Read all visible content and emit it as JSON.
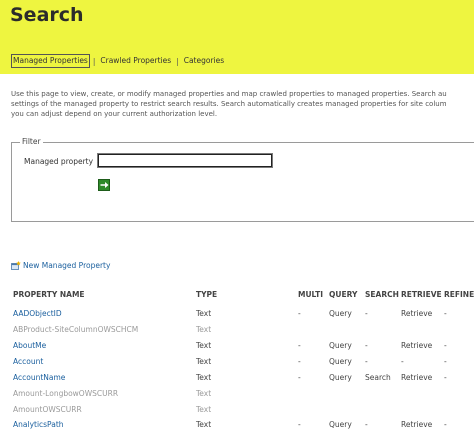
{
  "page": {
    "title": "Search"
  },
  "tabs": [
    {
      "label": "Managed Properties",
      "active": true
    },
    {
      "label": "Crawled Properties",
      "active": false
    },
    {
      "label": "Categories",
      "active": false
    }
  ],
  "tab_separator": "|",
  "description": {
    "line1": "Use this page to view, create, or modify managed properties and map crawled properties to managed properties. Search au",
    "line2": "settings of the managed property to restrict search results. Search automatically creates managed properties for site colum",
    "line3": "you can adjust depend on your current authorization level."
  },
  "filter": {
    "legend": "Filter",
    "label": "Managed property",
    "value": ""
  },
  "new_property_link": "New Managed Property",
  "table": {
    "headers": {
      "name": "PROPERTY NAME",
      "type": "TYPE",
      "multi": "MULTI",
      "query": "QUERY",
      "search": "SEARCH",
      "retrieve": "RETRIEVE",
      "refine": "REFINE"
    },
    "rows": [
      {
        "name": "AADObjectID",
        "type": "Text",
        "multi": "-",
        "query": "Query",
        "search": "-",
        "retrieve": "Retrieve",
        "refine": "-",
        "enabled": true
      },
      {
        "name": "ABProduct-SiteColumnOWSCHCM",
        "type": "Text",
        "multi": "",
        "query": "",
        "search": "",
        "retrieve": "",
        "refine": "",
        "enabled": false
      },
      {
        "name": "AboutMe",
        "type": "Text",
        "multi": "-",
        "query": "Query",
        "search": "-",
        "retrieve": "Retrieve",
        "refine": "-",
        "enabled": true
      },
      {
        "name": "Account",
        "type": "Text",
        "multi": "-",
        "query": "Query",
        "search": "-",
        "retrieve": "-",
        "refine": "-",
        "enabled": true
      },
      {
        "name": "AccountName",
        "type": "Text",
        "multi": "-",
        "query": "Query",
        "search": "Search",
        "retrieve": "Retrieve",
        "refine": "-",
        "enabled": true
      },
      {
        "name": "Amount-LongbowOWSCURR",
        "type": "Text",
        "multi": "",
        "query": "",
        "search": "",
        "retrieve": "",
        "refine": "",
        "enabled": false
      },
      {
        "name": "AmountOWSCURR",
        "type": "Text",
        "multi": "",
        "query": "",
        "search": "",
        "retrieve": "",
        "refine": "",
        "enabled": false
      },
      {
        "name": "AnalyticsPath",
        "type": "Text",
        "multi": "-",
        "query": "Query",
        "search": "-",
        "retrieve": "Retrieve",
        "refine": "-",
        "enabled": true
      }
    ]
  },
  "colors": {
    "banner": "#eef540",
    "link": "#1a5f9e",
    "disabled": "#9a9a9a",
    "go_button": "#2f8a2a"
  },
  "icons": {
    "go": "arrow-right-icon",
    "new_property": "new-property-icon"
  }
}
